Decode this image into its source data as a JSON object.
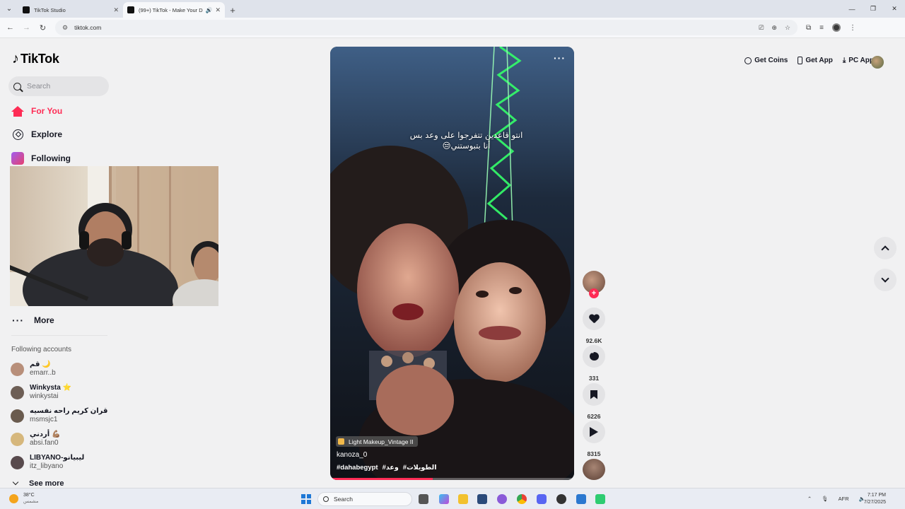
{
  "browser": {
    "tabs": [
      {
        "title": "TikTok Studio",
        "active": false
      },
      {
        "title": "(99+) TikTok - Make Your Day",
        "active": true
      }
    ],
    "url": "tiktok.com"
  },
  "brand": {
    "name": "TikTok"
  },
  "search": {
    "placeholder": "Search"
  },
  "nav": {
    "for_you": "For You",
    "explore": "Explore",
    "following": "Following",
    "more": "More"
  },
  "following_accounts": {
    "title": "Following accounts",
    "items": [
      {
        "name": "قم 🌙",
        "handle": "emarr..b",
        "color": "#b88f7a"
      },
      {
        "name": "Winkysta ⭐",
        "handle": "winkystai",
        "color": "#6d5e55"
      },
      {
        "name": "قران كريم راحه نفسيه",
        "handle": "msmsjc1",
        "color": "#6a5b4e"
      },
      {
        "name": "أردني 💪🏽",
        "handle": "absi.fan0",
        "color": "#d6b77c"
      },
      {
        "name": "LIBYANO-ليبيانو",
        "handle": "itz_libyano",
        "color": "#584a4d"
      }
    ],
    "see_more": "See more"
  },
  "video": {
    "caption_line1": "انتو قاعدين تتفرجوا على وعد بس",
    "caption_line2": "أنا بتبوستني😒",
    "effect": "Light Makeup_Vintage II",
    "author": "kanoza_0",
    "tags": [
      "#dahabegypt",
      "#وعد",
      "#الطويلات"
    ],
    "progress_fraction": 0.42
  },
  "actions": {
    "likes": "92.6K",
    "comments": "331",
    "saves": "6226",
    "shares": "8315"
  },
  "header": {
    "get_coins": "Get Coins",
    "get_app": "Get App",
    "pc_app": "PC App"
  },
  "taskbar": {
    "temp": "38°C",
    "weather_desc": "مشمس",
    "search": "Search",
    "lang": "AFR",
    "time": "7:17 PM",
    "date": "7/27/2025"
  },
  "colors": {
    "accent": "#fe2c55",
    "bg": "#f1f1f2"
  }
}
